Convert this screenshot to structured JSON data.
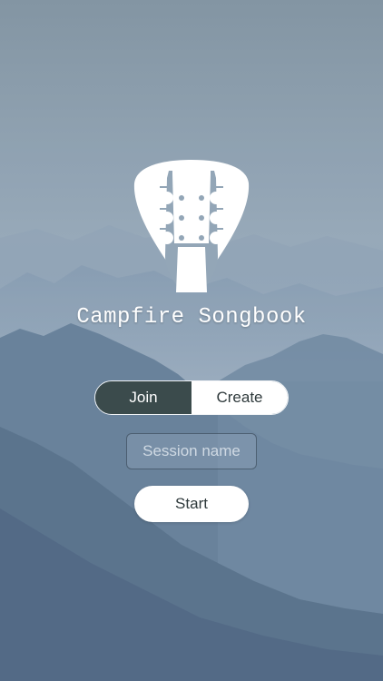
{
  "app": {
    "title": "Campfire Songbook",
    "logo_icon": "guitar-pick-headstock-icon"
  },
  "mode_switch": {
    "options": [
      "Join",
      "Create"
    ],
    "selected": "Join"
  },
  "session": {
    "placeholder": "Session name",
    "value": ""
  },
  "actions": {
    "start_label": "Start"
  },
  "colors": {
    "sky_top": "#7f93a4",
    "mountain_dark": "#4d6680",
    "segment_active": "#3b4b4c",
    "button_bg": "#ffffff"
  }
}
